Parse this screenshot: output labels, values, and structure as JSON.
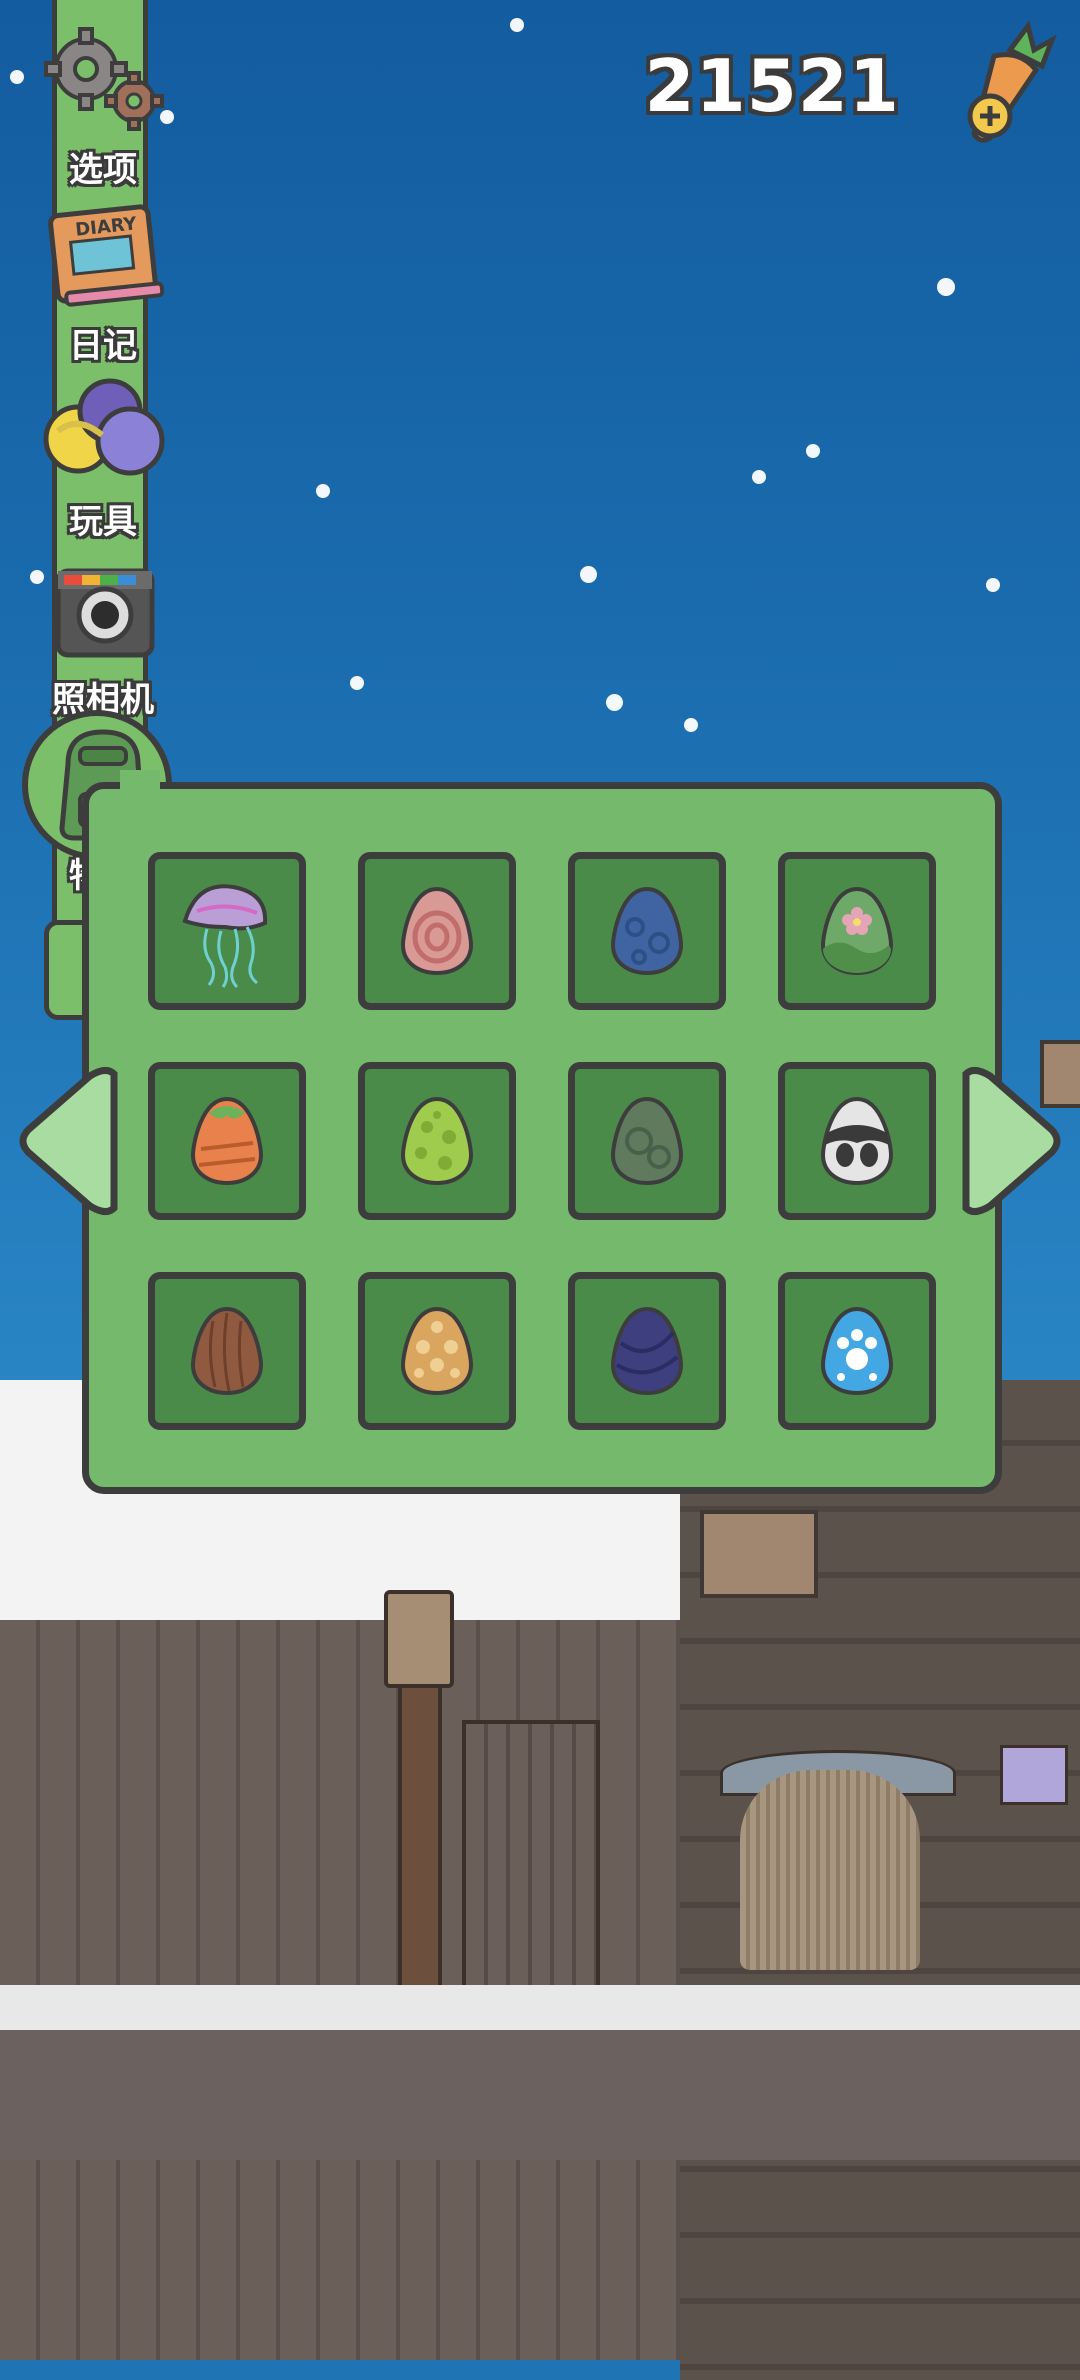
{
  "currency": {
    "amount": "21521"
  },
  "sidebar": {
    "items": [
      {
        "label": "选项",
        "icon": "gears-icon"
      },
      {
        "label": "日记",
        "icon": "diary-icon",
        "diary_text": "DIARY"
      },
      {
        "label": "玩具",
        "icon": "toys-icon"
      },
      {
        "label": "照相机",
        "icon": "camera-icon"
      },
      {
        "label": "物品",
        "icon": "backpack-icon",
        "selected": true
      }
    ]
  },
  "inventory": {
    "slots": [
      {
        "item": "jellyfish",
        "colors": [
          "#b99fd6",
          "#6fd0d2"
        ]
      },
      {
        "item": "egg-red-rings",
        "colors": [
          "#d99a95",
          "#c06d6b"
        ]
      },
      {
        "item": "egg-blue-spots",
        "colors": [
          "#3f64a1",
          "#2d4f86"
        ]
      },
      {
        "item": "egg-flower",
        "colors": [
          "#6fa96a",
          "#e6a4b7"
        ]
      },
      {
        "item": "egg-orange-leaf",
        "colors": [
          "#e9814c",
          "#6db25a"
        ]
      },
      {
        "item": "egg-green-spots",
        "colors": [
          "#9fcc4d",
          "#7eac35"
        ]
      },
      {
        "item": "egg-dark-green",
        "colors": [
          "#5f7a5c",
          "#46604a"
        ]
      },
      {
        "item": "egg-panda",
        "colors": [
          "#e5e5e5",
          "#3a3a3a"
        ]
      },
      {
        "item": "egg-wood",
        "colors": [
          "#8f5a3f",
          "#6e3f2b"
        ]
      },
      {
        "item": "egg-tan-spots",
        "colors": [
          "#d9a55f",
          "#efcf93"
        ]
      },
      {
        "item": "egg-indigo",
        "colors": [
          "#3e3f7f",
          "#2a2c63"
        ]
      },
      {
        "item": "egg-blue-paw",
        "colors": [
          "#43a7e3",
          "#ffffff"
        ]
      }
    ]
  },
  "colors": {
    "panel": "#74b96c",
    "slot": "#4a8b4a",
    "outline": "#3d3d3d"
  }
}
